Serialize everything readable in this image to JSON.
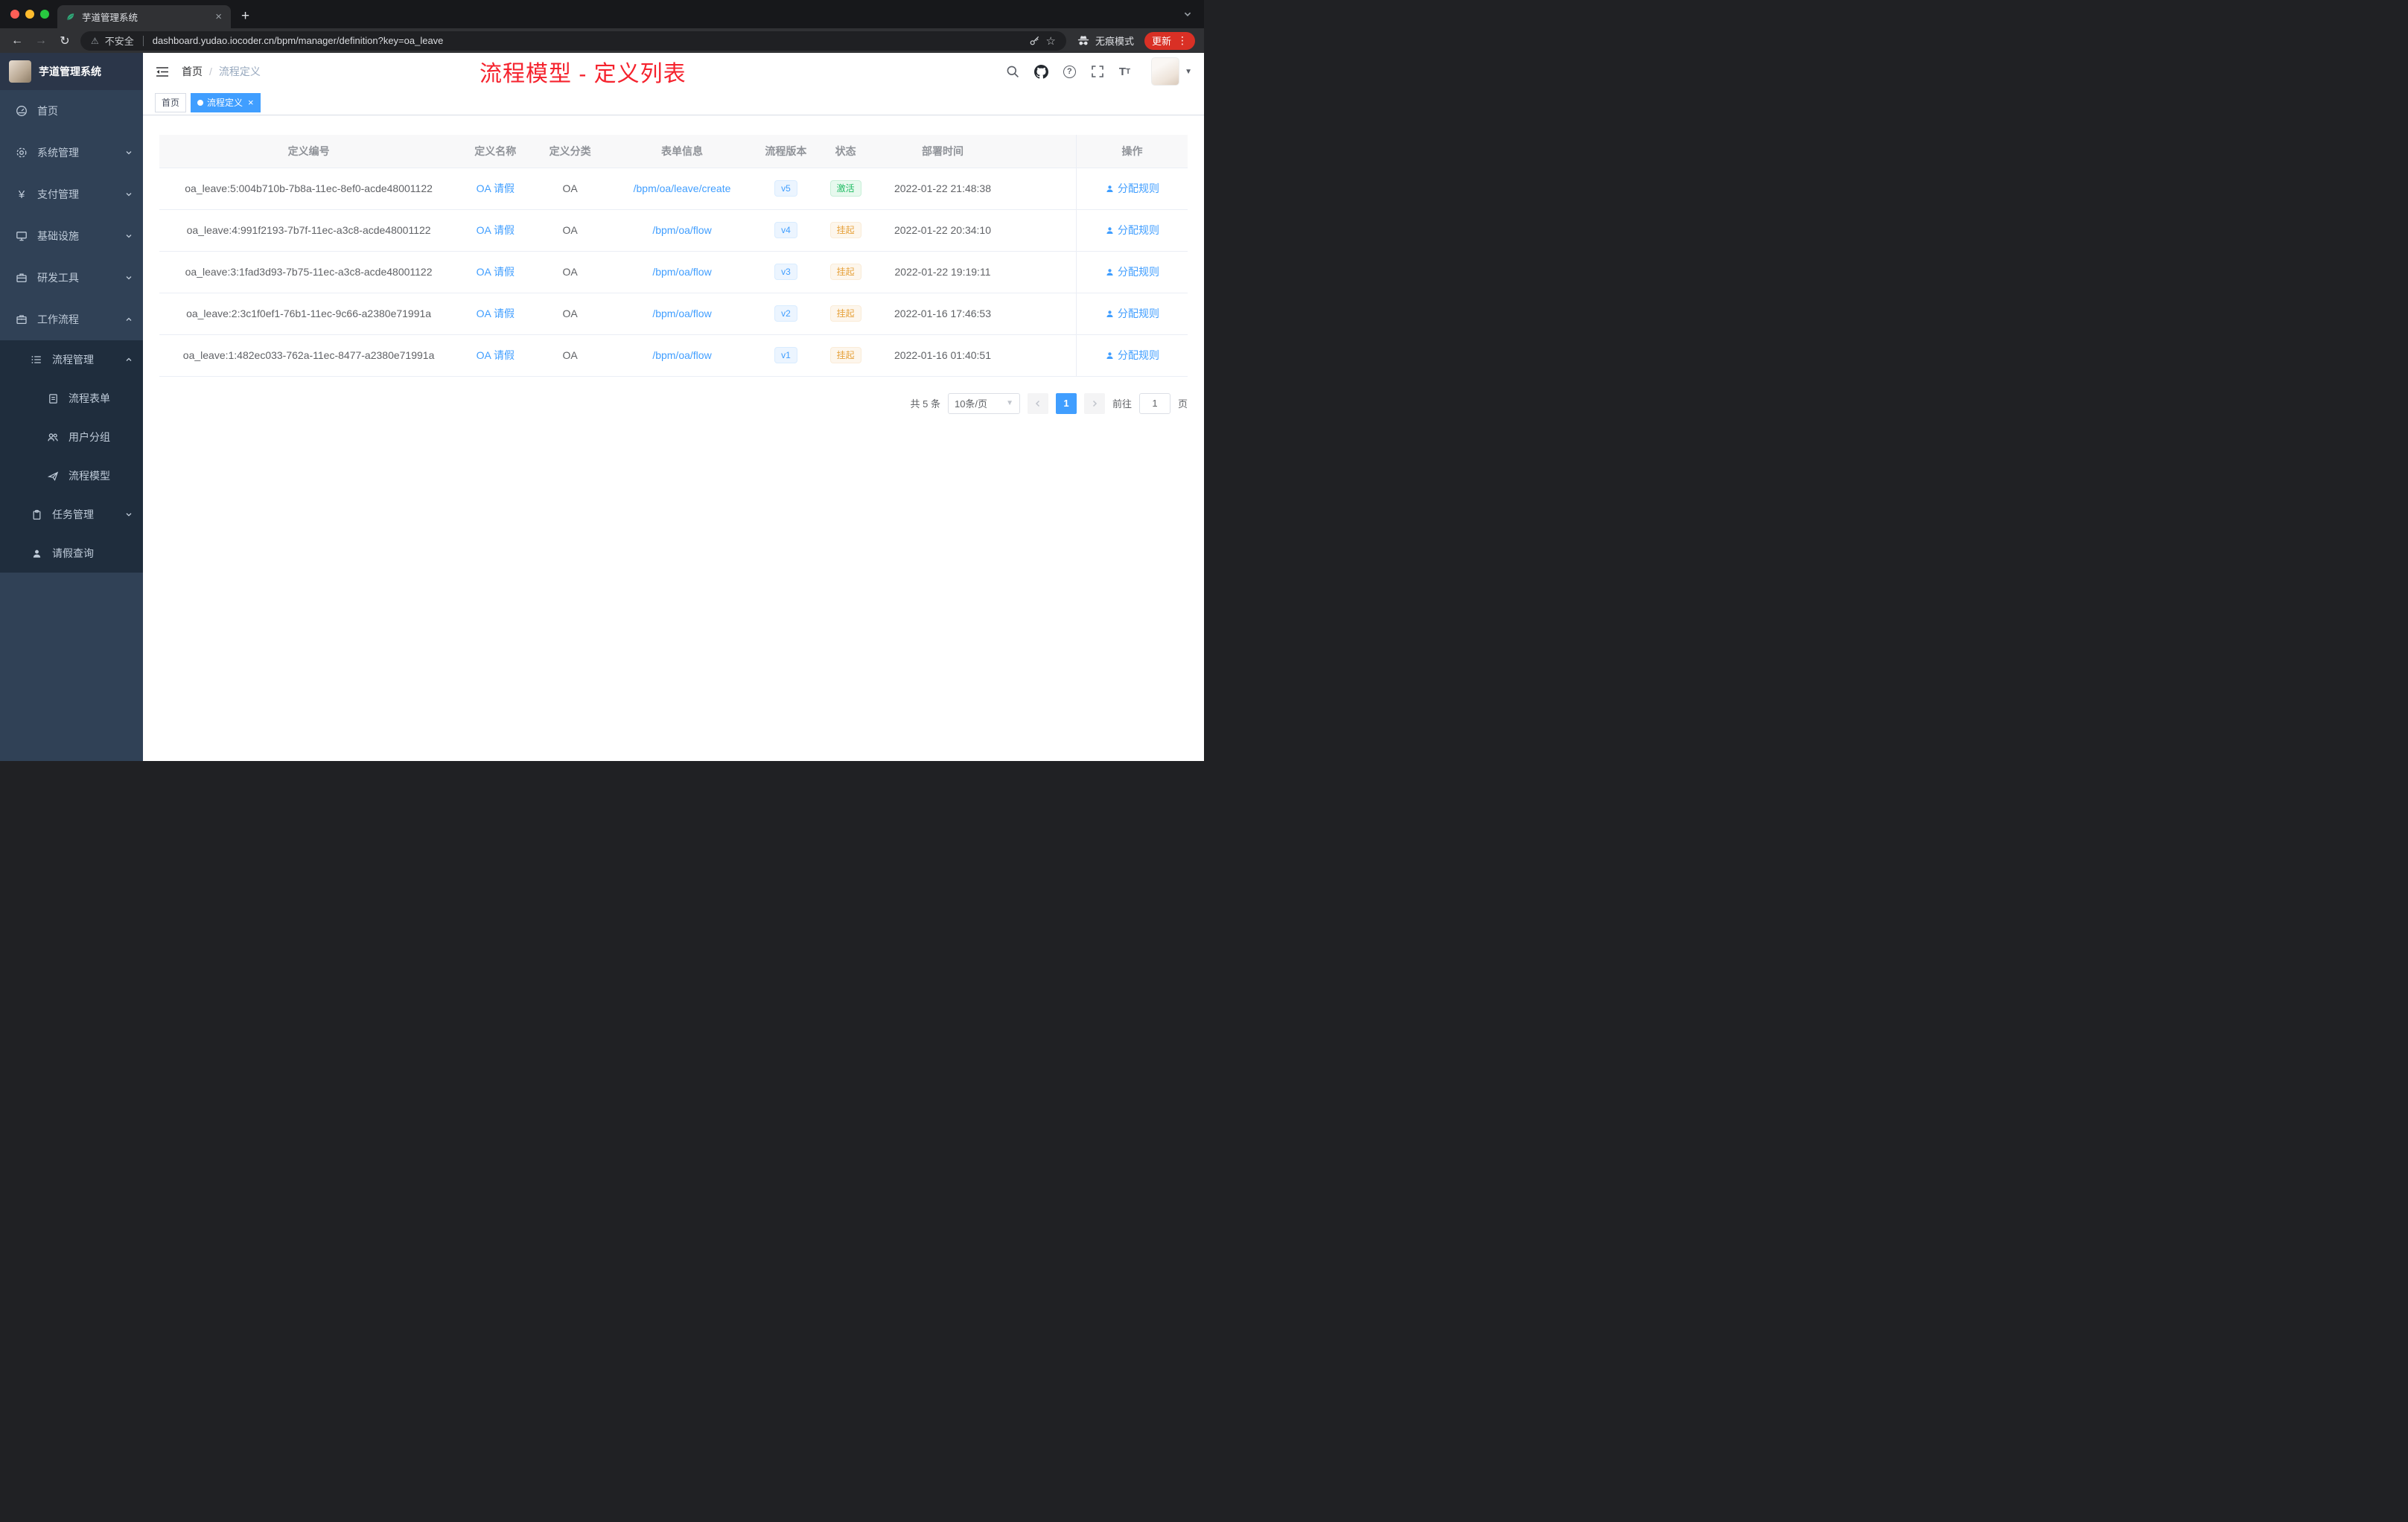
{
  "colors": {
    "primary": "#409eff",
    "success": "#1fbc63",
    "warning": "#e6a23c",
    "annotation_red": "#f5222d",
    "sidebar_bg": "#304156"
  },
  "browser": {
    "tab_title": "芋道管理系统",
    "security_label": "不安全",
    "url": "dashboard.yudao.iocoder.cn/bpm/manager/definition?key=oa_leave",
    "incognito_label": "无痕模式",
    "update_label": "更新"
  },
  "sidebar": {
    "logo_title": "芋道管理系统",
    "items": [
      {
        "label": "首页",
        "icon": "dashboard-icon"
      },
      {
        "label": "系统管理",
        "icon": "gear-icon"
      },
      {
        "label": "支付管理",
        "icon": "yen-icon"
      },
      {
        "label": "基础设施",
        "icon": "monitor-icon"
      },
      {
        "label": "研发工具",
        "icon": "toolbox-icon"
      },
      {
        "label": "工作流程",
        "icon": "briefcase-icon"
      },
      {
        "label": "流程管理",
        "icon": "list-icon"
      },
      {
        "label": "流程表单",
        "icon": "form-icon"
      },
      {
        "label": "用户分组",
        "icon": "users-icon"
      },
      {
        "label": "流程模型",
        "icon": "paper-plane-icon"
      },
      {
        "label": "任务管理",
        "icon": "clipboard-icon"
      },
      {
        "label": "请假查询",
        "icon": "user-icon"
      }
    ]
  },
  "header": {
    "breadcrumb": {
      "home": "首页",
      "separator": "/",
      "current": "流程定义"
    },
    "annotation": "流程模型 - 定义列表"
  },
  "tags": {
    "items": [
      {
        "label": "首页",
        "active": false
      },
      {
        "label": "流程定义",
        "active": true
      }
    ]
  },
  "table": {
    "columns": [
      "定义编号",
      "定义名称",
      "定义分类",
      "表单信息",
      "流程版本",
      "状态",
      "部署时间",
      "操作"
    ],
    "rows": [
      {
        "id": "oa_leave:5:004b710b-7b8a-11ec-8ef0-acde48001122",
        "name": "OA 请假",
        "category": "OA",
        "form": "/bpm/oa/leave/create",
        "version": "v5",
        "status": "激活",
        "status_type": "success",
        "deploy_time": "2022-01-22 21:48:38",
        "action": "分配规则"
      },
      {
        "id": "oa_leave:4:991f2193-7b7f-11ec-a3c8-acde48001122",
        "name": "OA 请假",
        "category": "OA",
        "form": "/bpm/oa/flow",
        "version": "v4",
        "status": "挂起",
        "status_type": "warning",
        "deploy_time": "2022-01-22 20:34:10",
        "action": "分配规则"
      },
      {
        "id": "oa_leave:3:1fad3d93-7b75-11ec-a3c8-acde48001122",
        "name": "OA 请假",
        "category": "OA",
        "form": "/bpm/oa/flow",
        "version": "v3",
        "status": "挂起",
        "status_type": "warning",
        "deploy_time": "2022-01-22 19:19:11",
        "action": "分配规则"
      },
      {
        "id": "oa_leave:2:3c1f0ef1-76b1-11ec-9c66-a2380e71991a",
        "name": "OA 请假",
        "category": "OA",
        "form": "/bpm/oa/flow",
        "version": "v2",
        "status": "挂起",
        "status_type": "warning",
        "deploy_time": "2022-01-16 17:46:53",
        "action": "分配规则"
      },
      {
        "id": "oa_leave:1:482ec033-762a-11ec-8477-a2380e71991a",
        "name": "OA 请假",
        "category": "OA",
        "form": "/bpm/oa/flow",
        "version": "v1",
        "status": "挂起",
        "status_type": "warning",
        "deploy_time": "2022-01-16 01:40:51",
        "action": "分配规则"
      }
    ]
  },
  "pagination": {
    "total_label": "共 5 条",
    "page_size": "10条/页",
    "current_page": "1",
    "goto_label": "前往",
    "goto_value": "1",
    "page_unit": "页"
  }
}
